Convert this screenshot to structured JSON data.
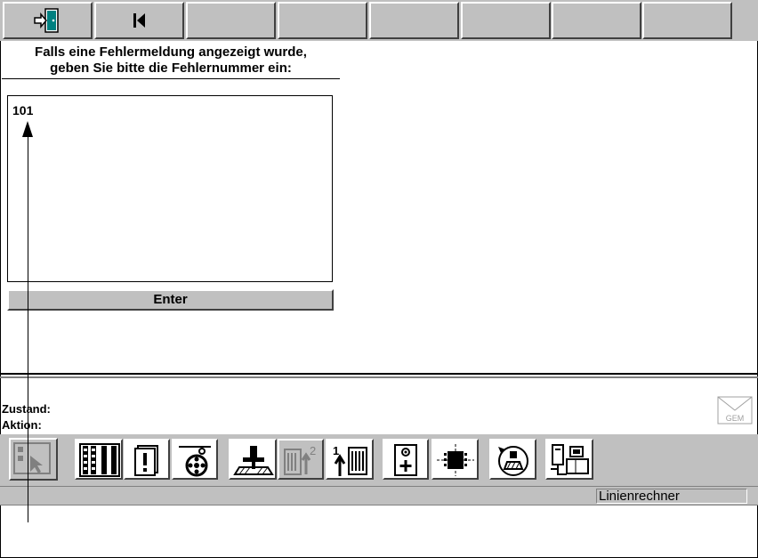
{
  "toolbar": {
    "buttons": [
      {
        "icon": "exit-door-icon"
      },
      {
        "icon": "skip-to-start-icon"
      },
      {
        "icon": ""
      },
      {
        "icon": ""
      },
      {
        "icon": ""
      },
      {
        "icon": ""
      },
      {
        "icon": ""
      },
      {
        "icon": ""
      }
    ]
  },
  "main": {
    "prompt_line1": "Falls eine Fehlermeldung angezeigt wurde,",
    "prompt_line2": "geben Sie bitte die Fehlernummer ein:",
    "error_number_value": "101",
    "enter_label": "Enter"
  },
  "status": {
    "zustand_label": "Zustand:",
    "aktion_label": "Aktion:",
    "message_icon": "gem-mail-icon"
  },
  "iconbar": {
    "icons": [
      "select-cursor-icon",
      "film-strip-icon",
      "alert-card-icon",
      "reel-feed-icon",
      "press-station-icon",
      "stack-step-2-icon",
      "stack-step-1-icon",
      "camera-add-icon",
      "chip-module-icon",
      "rotate-station-icon",
      "computer-network-icon"
    ]
  },
  "statusbar": {
    "computer_name": "Linienrechner"
  },
  "colors": {
    "panel": "#c0c0c0",
    "door_icon": "#008080",
    "text": "#000000"
  }
}
